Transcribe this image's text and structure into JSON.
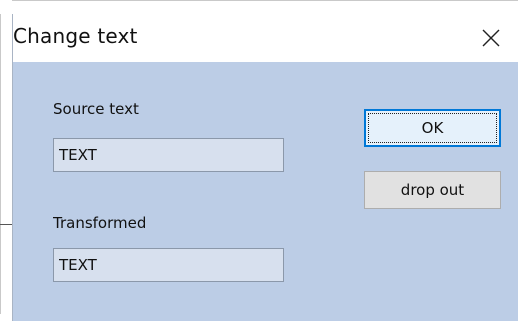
{
  "dialog": {
    "title": "Change text",
    "close_label": "×",
    "source": {
      "label": "Source text",
      "value": "TEXT"
    },
    "transformed": {
      "label": "Transformed",
      "value": "TEXT"
    },
    "buttons": {
      "ok": "OK",
      "drop_out": "drop out"
    }
  },
  "colors": {
    "dialog_background": "#bccde6",
    "field_background": "#d7e0ee",
    "focus_border": "#0078d7",
    "button_face": "#e1e1e1"
  },
  "icons": {
    "close": "close-icon"
  }
}
